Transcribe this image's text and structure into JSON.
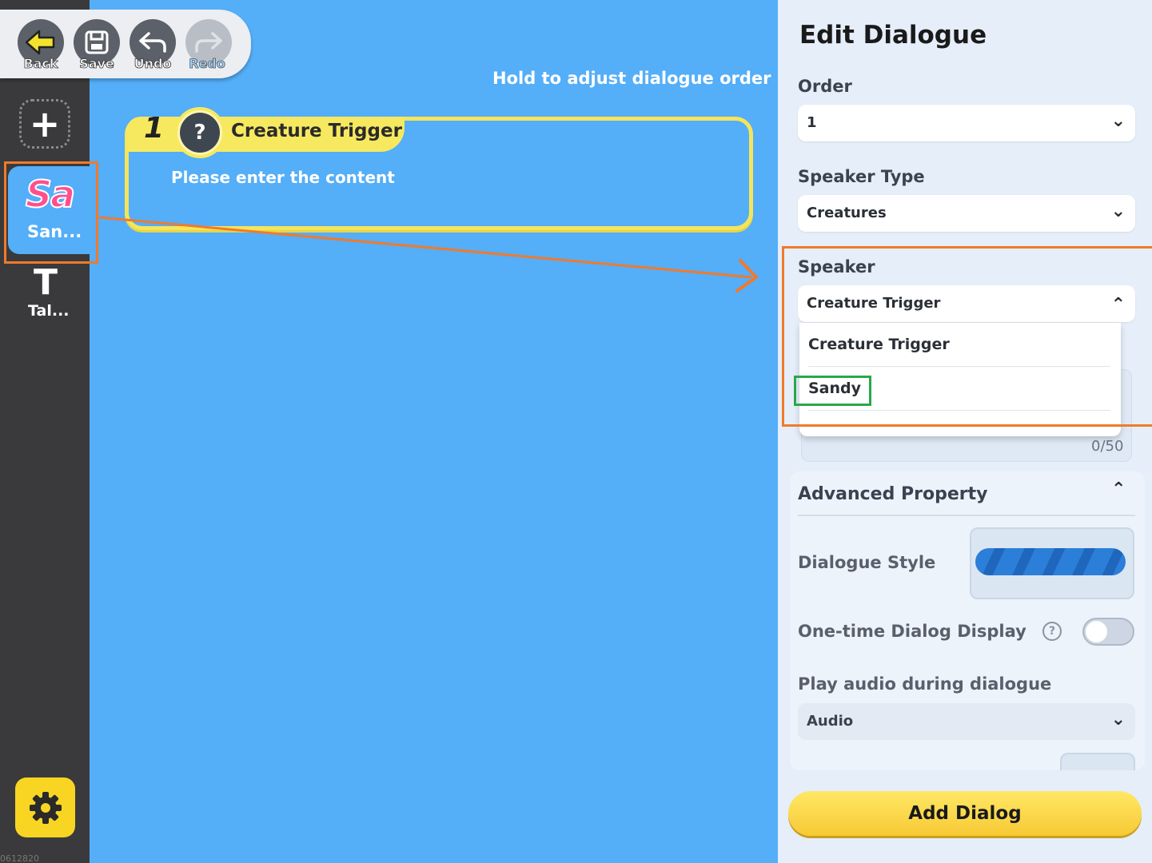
{
  "toolbar": {
    "back_label": "Back",
    "save_label": "Save",
    "undo_label": "Undo",
    "redo_label": "Redo"
  },
  "rail": {
    "items": [
      {
        "icon_text": "Sa",
        "label": "San..."
      },
      {
        "icon_text": "T",
        "label": "Tal..."
      }
    ],
    "code": "0612820"
  },
  "canvas": {
    "hint": "Hold to adjust dialogue order",
    "card": {
      "order": "1",
      "speaker": "Creature Trigger",
      "content": "Please enter the content"
    }
  },
  "panel": {
    "title": "Edit Dialogue",
    "order_label": "Order",
    "order_value": "1",
    "speaker_type_label": "Speaker Type",
    "speaker_type_value": "Creatures",
    "speaker_label": "Speaker",
    "speaker_value": "Creature Trigger",
    "speaker_options": [
      "Creature Trigger",
      "Sandy"
    ],
    "counter": "0/50",
    "advanced": {
      "title": "Advanced Property",
      "dialogue_style_label": "Dialogue Style",
      "one_time_label": "One-time Dialog Display",
      "one_time_enabled": false,
      "audio_label": "Play audio during dialogue",
      "audio_value": "Audio"
    },
    "add_button": "Add Dialog"
  },
  "colors": {
    "canvas_bg": "#54aef8",
    "accent_yellow": "#f7e95f",
    "highlight_orange": "#f07a2c",
    "highlight_green": "#2aa74a"
  }
}
